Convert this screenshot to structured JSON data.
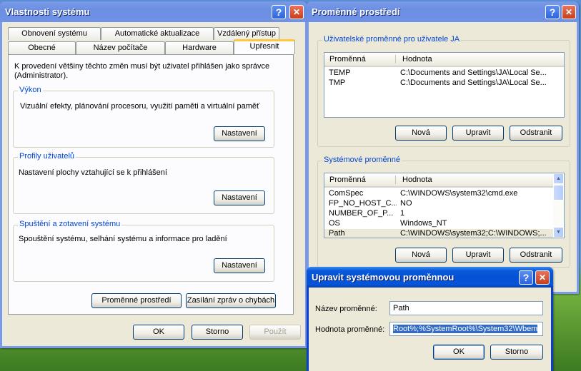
{
  "props": {
    "title": "Vlastnosti systému",
    "tabs_row1": [
      "Obnovení systému",
      "Automatické aktualizace",
      "Vzdálený přístup"
    ],
    "tabs_row2": [
      "Obecné",
      "Název počítače",
      "Hardware",
      "Upřesnit"
    ],
    "intro": "K provedení většiny těchto změn musí být uživatel přihlášen jako správce (Administrator).",
    "groups": [
      {
        "label": "Výkon",
        "text": "Vizuální efekty, plánování procesoru, využití paměti a virtuální paměť",
        "button": "Nastavení"
      },
      {
        "label": "Profily uživatelů",
        "text": "Nastavení plochy vztahující se k přihlášení",
        "button": "Nastavení"
      },
      {
        "label": "Spuštění a zotavení systému",
        "text": "Spouštění systému, selhání systému a informace pro ladění",
        "button": "Nastavení"
      }
    ],
    "env_button": "Proměnné prostředí",
    "error_button": "Zasílání zpráv o chybách",
    "ok": "OK",
    "cancel": "Storno",
    "apply": "Použít"
  },
  "env": {
    "title": "Proměnné prostředí",
    "user_group": "Uživatelské proměnné pro uživatele JA",
    "col_name": "Proměnná",
    "col_value": "Hodnota",
    "user_vars": [
      {
        "name": "TEMP",
        "value": "C:\\Documents and Settings\\JA\\Local Se..."
      },
      {
        "name": "TMP",
        "value": "C:\\Documents and Settings\\JA\\Local Se..."
      }
    ],
    "system_group": "Systémové proměnné",
    "system_vars": [
      {
        "name": "ComSpec",
        "value": "C:\\WINDOWS\\system32\\cmd.exe"
      },
      {
        "name": "FP_NO_HOST_C...",
        "value": "NO"
      },
      {
        "name": "NUMBER_OF_P...",
        "value": "1"
      },
      {
        "name": "OS",
        "value": "Windows_NT"
      },
      {
        "name": "Path",
        "value": "C:\\WINDOWS\\system32;C:\\WINDOWS;..."
      }
    ],
    "new": "Nová",
    "edit": "Upravit",
    "delete": "Odstranit"
  },
  "edit": {
    "title": "Upravit systémovou proměnnou",
    "name_label": "Název proměnné:",
    "name_value": "Path",
    "value_label": "Hodnota proměnné:",
    "value_value": "Root%;%SystemRoot%\\System32\\Wbem",
    "ok": "OK",
    "cancel": "Storno"
  },
  "icons": {
    "help": "?",
    "close": "✕",
    "scroll_up": "▲",
    "scroll_down": "▼"
  },
  "colors": {
    "titlebar_active": "#0551d6",
    "titlebar_inactive": "#7a9be8",
    "selection": "#316ac5",
    "group_label": "#0046d5"
  }
}
